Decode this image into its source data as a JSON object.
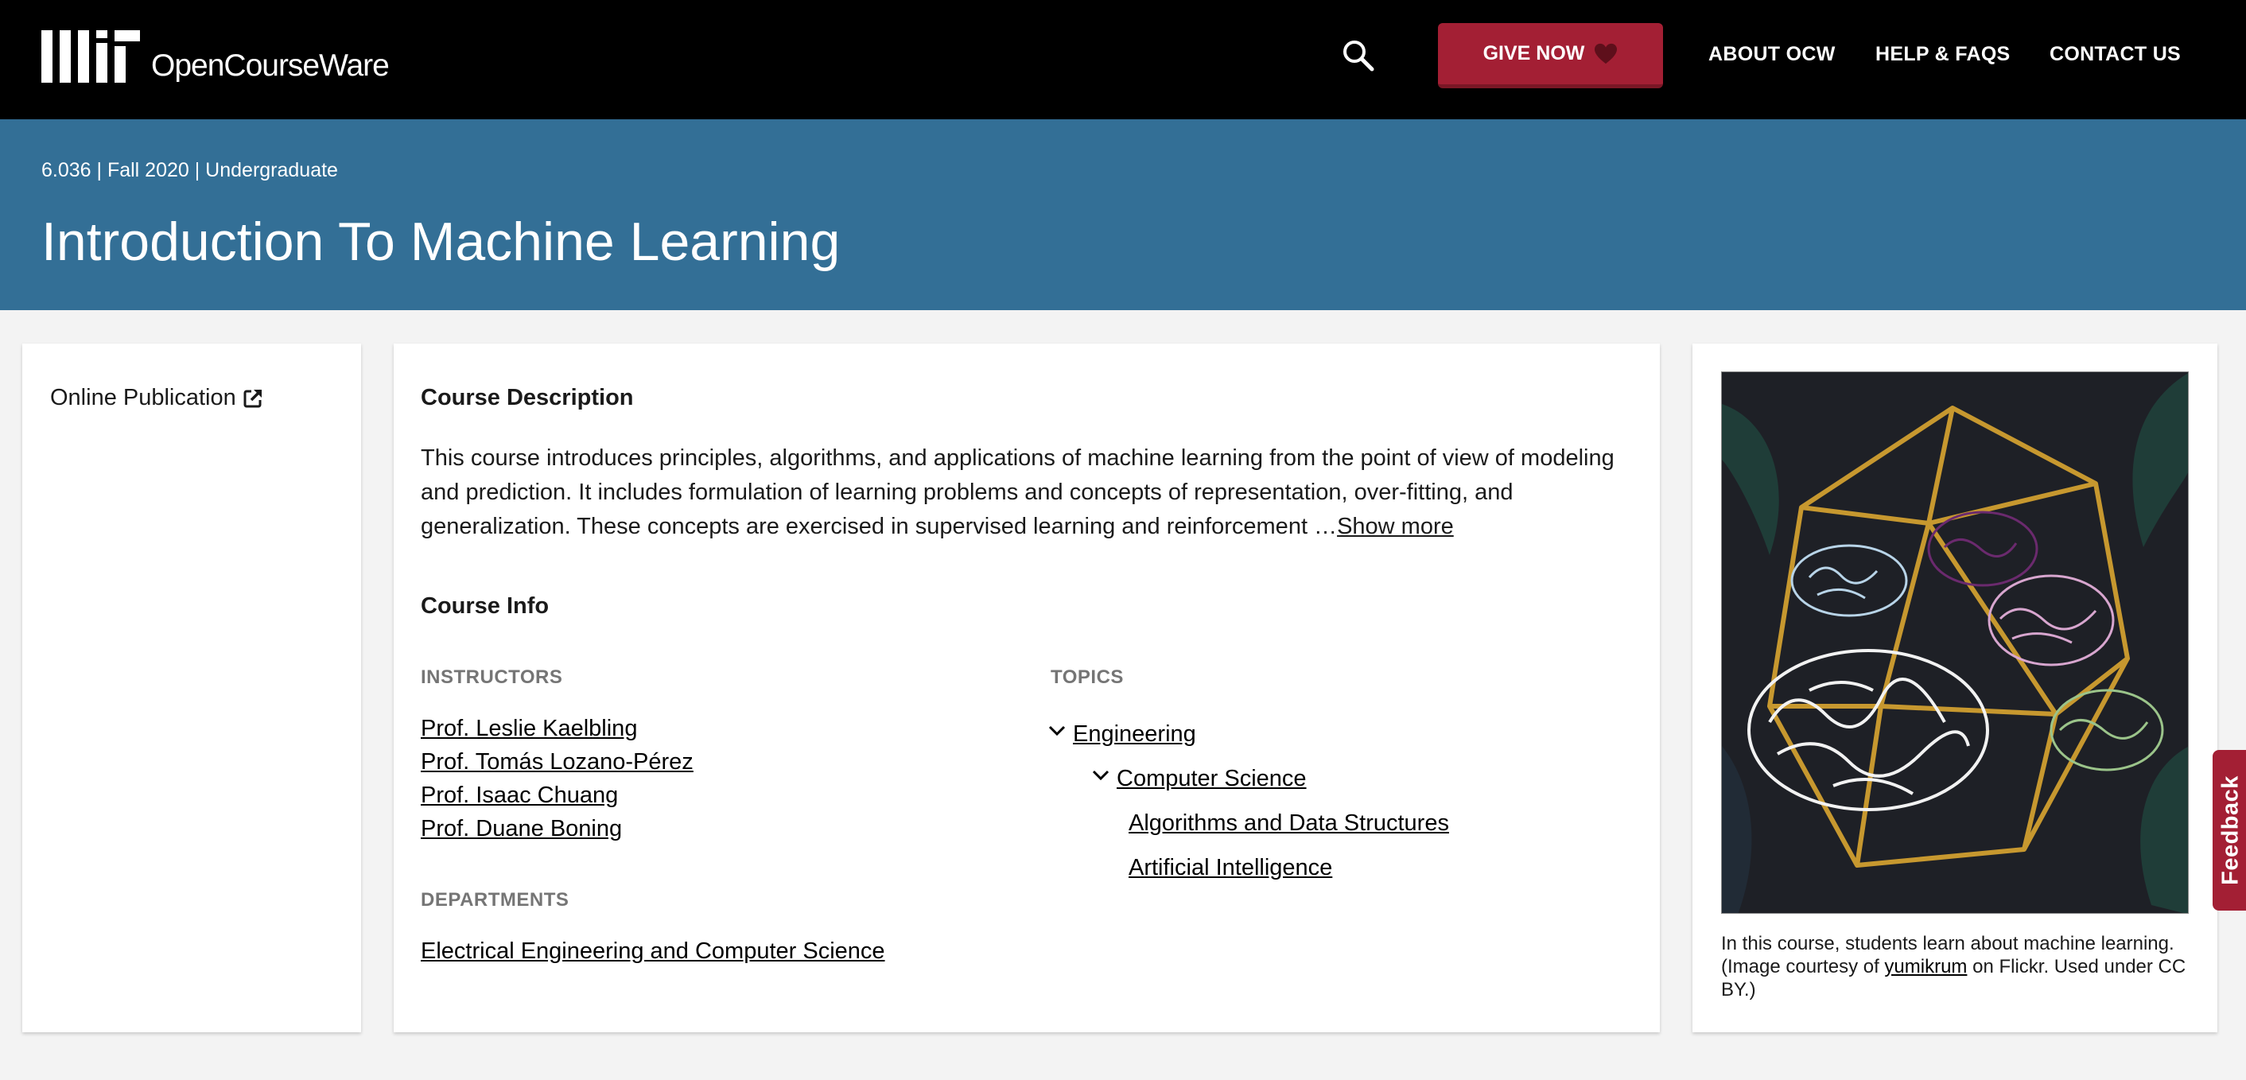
{
  "header": {
    "logo_text": "OpenCourseWare",
    "give_label": "GIVE NOW",
    "nav": [
      "ABOUT OCW",
      "HELP & FAQS",
      "CONTACT US"
    ]
  },
  "banner": {
    "meta": "6.036 | Fall 2020 | Undergraduate",
    "title": "Introduction To Machine Learning"
  },
  "sidebar": {
    "online_publication": "Online Publication"
  },
  "main": {
    "description_heading": "Course Description",
    "description_text": "This course introduces principles, algorithms, and applications of machine learning from the point of view of modeling and prediction. It includes formulation of learning problems and concepts of representation, over-fitting, and generalization. These concepts are exercised in supervised learning and reinforcement …",
    "show_more": "Show more",
    "info_heading": "Course Info",
    "instructors_label": "INSTRUCTORS",
    "instructors": [
      "Prof. Leslie Kaelbling",
      "Prof. Tomás Lozano-Pérez",
      "Prof. Isaac Chuang",
      "Prof. Duane Boning"
    ],
    "departments_label": "DEPARTMENTS",
    "department": "Electrical Engineering and Computer Science",
    "topics_label": "TOPICS",
    "topics": {
      "level1": "Engineering",
      "level2": "Computer Science",
      "level3": [
        "Algorithms and Data Structures",
        "Artificial Intelligence"
      ]
    }
  },
  "image_card": {
    "caption_pre": "In this course, students learn about machine learning. (Image courtesy of ",
    "caption_link": "yumikrum",
    "caption_post": " on Flickr. Used under CC BY.)"
  },
  "feedback_label": "Feedback",
  "colors": {
    "header_bg": "#000000",
    "banner_bg": "#336f96",
    "accent_red": "#a31f34",
    "page_bg": "#f3f3f3"
  }
}
